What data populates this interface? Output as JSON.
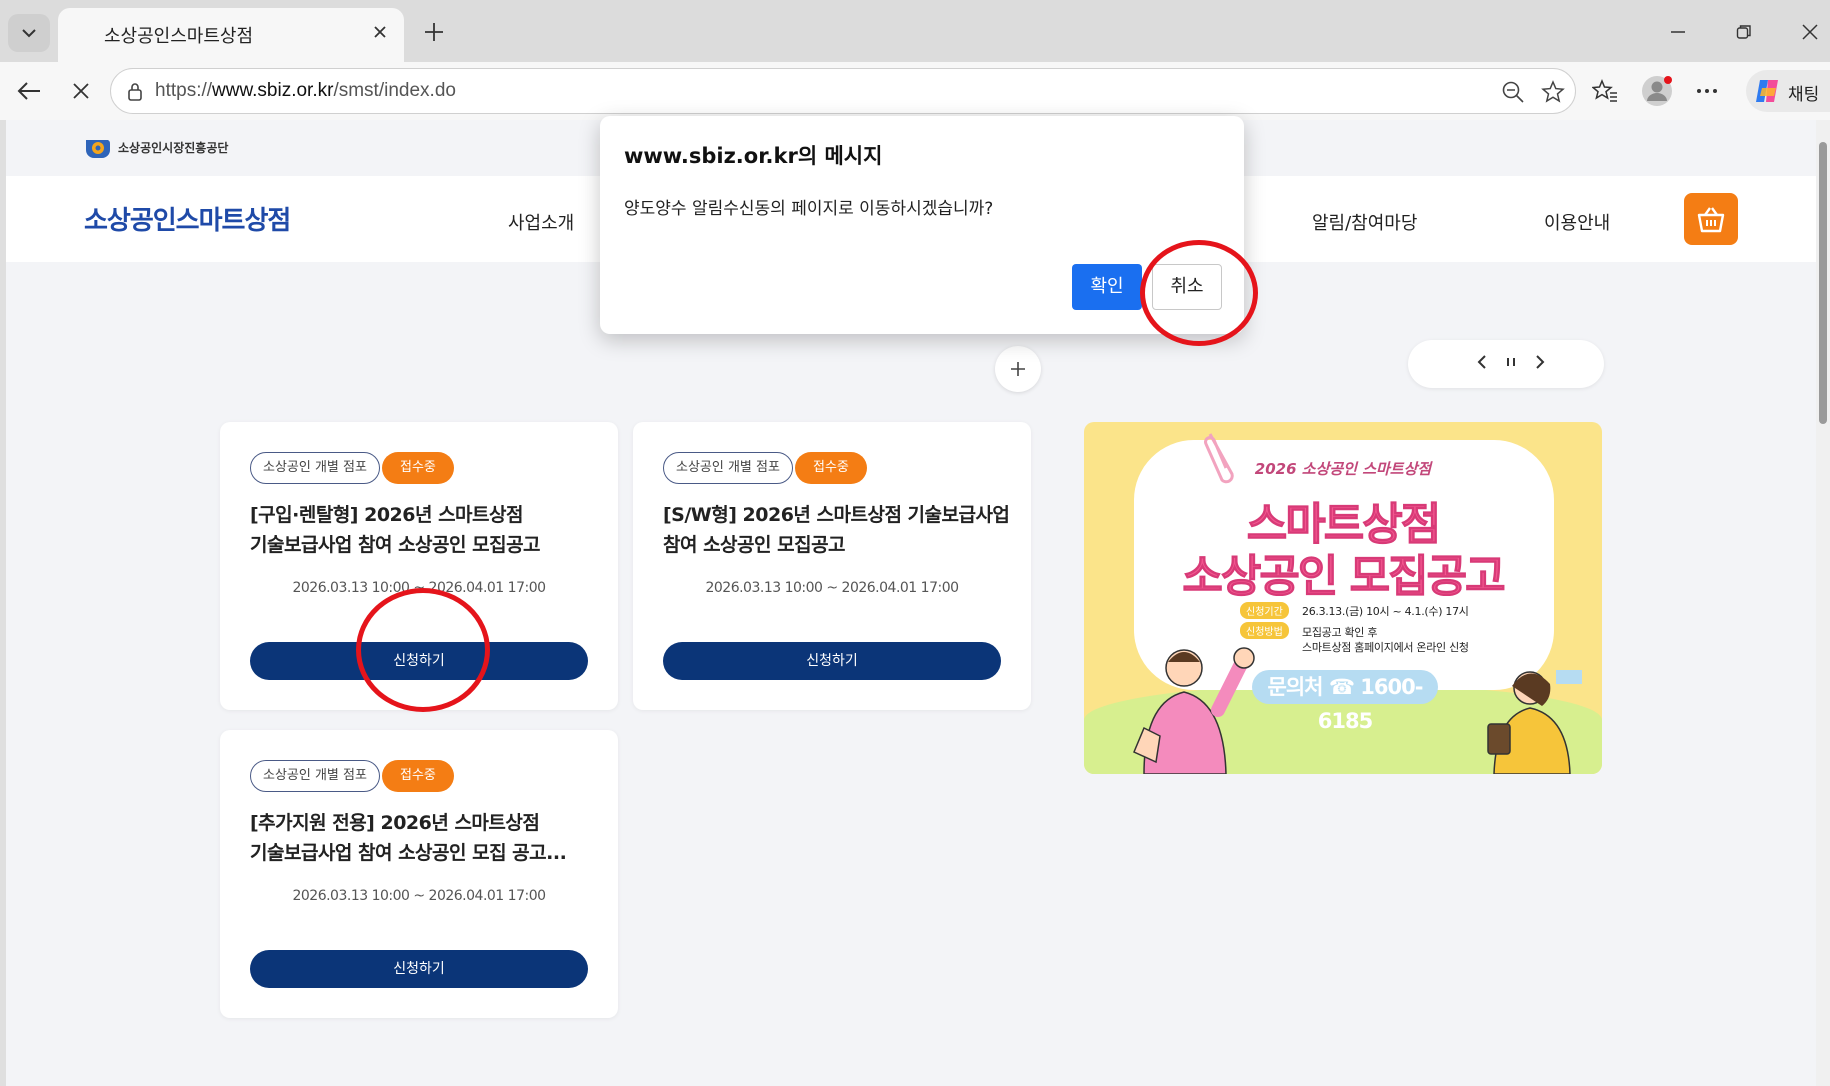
{
  "browser": {
    "tab_title": "소상공인스마트상점",
    "url_prefix": "https://",
    "url_domain": "www.sbiz.or.kr",
    "url_path": "/smst/index.do",
    "copilot_label": "채팅"
  },
  "page": {
    "org_name": "소상공인시장진흥공단",
    "site_title": "소상공인스마트상점",
    "menu": [
      "사업소개",
      "알림/참여마당",
      "이용안내"
    ]
  },
  "cards": [
    {
      "badge_type": "소상공인 개별 점포",
      "badge_status": "접수중",
      "title_line1": "[구입·렌탈형] 2026년 스마트상점",
      "title_line2": "기술보급사업 참여 소상공인 모집공고",
      "period": "2026.03.13 10:00 ~ 2026.04.01 17:00",
      "button": "신청하기"
    },
    {
      "badge_type": "소상공인 개별 점포",
      "badge_status": "접수중",
      "title_line1": "[S/W형] 2026년 스마트상점 기술보급사업",
      "title_line2": "참여 소상공인 모집공고",
      "period": "2026.03.13 10:00 ~ 2026.04.01 17:00",
      "button": "신청하기"
    },
    {
      "badge_type": "소상공인 개별 점포",
      "badge_status": "접수중",
      "title_line1": "[추가지원 전용] 2026년 스마트상점",
      "title_line2": "기술보급사업 참여 소상공인 모집 공고...",
      "period": "2026.03.13 10:00 ~ 2026.04.01 17:00",
      "button": "신청하기"
    }
  ],
  "banner": {
    "small_title": "2026 소상공인 스마트상점",
    "big_line1": "스마트상점",
    "big_line2": "소상공인 모집공고",
    "tag_period": "신청기간",
    "period_text": "26.3.13.(금) 10시 ~ 4.1.(수) 17시",
    "tag_method": "신청방법",
    "method_line1": "모집공고 확인 후",
    "method_line2": "스마트상점 홈페이지에서 온라인 신청",
    "contact": "문의처 ☎ 1600-6185"
  },
  "dialog": {
    "title": "www.sbiz.or.kr의 메시지",
    "message": "양도양수 알림수신동의 페이지로 이동하시겠습니까?",
    "ok": "확인",
    "cancel": "취소"
  },
  "colors": {
    "accent_orange": "#f47d14",
    "button_navy": "#0b3578",
    "dialog_blue": "#1a6ff0",
    "annotation_red": "#e5141b"
  }
}
